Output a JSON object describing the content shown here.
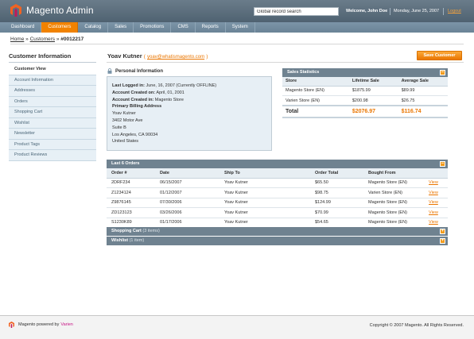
{
  "app": {
    "title": "Magento Admin",
    "search_value": "Global record search",
    "welcome": "Welcome, John Doe",
    "date": "Monday, June 25, 2007",
    "logout": "Logout"
  },
  "nav": [
    "Dashboard",
    "Customers",
    "Catalog",
    "Sales",
    "Promotions",
    "CMS",
    "Reports",
    "System"
  ],
  "breadcrumb": {
    "home": "Home",
    "sep": "»",
    "customers": "Customers",
    "current": "#0012217"
  },
  "sidebar": {
    "title": "Customer Information",
    "items": [
      "Customer View",
      "Account Information",
      "Addresses",
      "Orders",
      "Shopping Cart",
      "Wishlist",
      "Newsletter",
      "Product Tags",
      "Product Reviews"
    ]
  },
  "customer": {
    "name": "Yoav Kutner",
    "email": "yoav@whatismagento.com",
    "save_label": "Save Customer"
  },
  "personal_info": {
    "title": "Personal Information",
    "last_logged_label": "Last Logged in:",
    "last_logged_value": "June, 16, 2007 (Currently OFFLINE)",
    "created_on_label": "Account Created on:",
    "created_on_value": "April, 01, 2001",
    "created_in_label": "Account Created in:",
    "created_in_value": "Magento Store",
    "billing_label": "Primary Billing Address",
    "address": [
      "Yoav Kutner",
      "3402 Motor Ave",
      "Suite B",
      "Los Angeles, CA 90034",
      "United States"
    ]
  },
  "sales_statistics": {
    "title": "Sales Statistics",
    "headers": [
      "Store",
      "Lifetime Sale",
      "Average Sale"
    ],
    "rows": [
      [
        "Magento Store (EN)",
        "$1875.99",
        "$89.99"
      ],
      [
        "Varien Store (EN)",
        "$200.98",
        "$26.75"
      ]
    ],
    "total": [
      "Total",
      "$2076.97",
      "$116.74"
    ],
    "toggle": "–"
  },
  "orders": {
    "title": "Last 6 Orders",
    "headers": [
      "Order #",
      "Date",
      "Ship To",
      "Order Total",
      "Bought From",
      ""
    ],
    "rows": [
      [
        "2DRF234",
        "06/15/2007",
        "Yoav Kutner",
        "$65.50",
        "Magento Store (EN)",
        "View"
      ],
      [
        "Z1234124",
        "01/12/2007",
        "Yoav Kutner",
        "$98.75",
        "Varien Store (EN)",
        "View"
      ],
      [
        "Z9876145",
        "07/30/2006",
        "Yoav Kutner",
        "$124.99",
        "Magento Store (EN)",
        "View"
      ],
      [
        "ZD123123",
        "03/26/2006",
        "Yoav Kutner",
        "$70.99",
        "Magento Store (EN)",
        "View"
      ],
      [
        "S1230K89",
        "01/17/2006",
        "Yoav Kutner",
        "$54.65",
        "Magento Store (EN)",
        "View"
      ]
    ],
    "toggle": "–"
  },
  "shopping_cart": {
    "title": "Shopping Cart",
    "note": "(3 items)",
    "toggle": "+"
  },
  "wishlist": {
    "title": "Wishlist",
    "note": "(1 item)",
    "toggle": "+"
  },
  "footer": {
    "powered_prefix": "Magento powered by",
    "powered_brand": "Varien",
    "copyright": "Copyright © 2007 Magento. All Rights Reserved."
  },
  "colors": {
    "accent": "#f18200",
    "header": "#4f6271",
    "panel_head": "#6f8290",
    "brand_pink": "#c71585"
  }
}
